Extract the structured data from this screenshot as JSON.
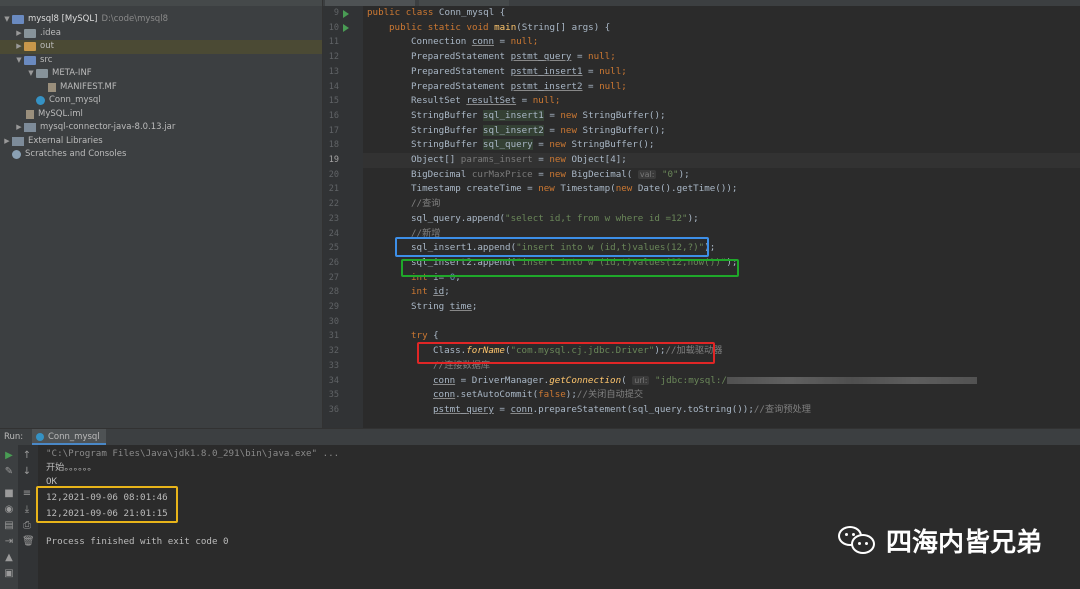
{
  "project_tree": {
    "items": [
      {
        "label": "mysql8 [MySQL]",
        "path": "D:\\code\\mysql8",
        "icon": "folder-icon"
      },
      {
        "label": ".idea",
        "icon": "folder-icon"
      },
      {
        "label": "out",
        "icon": "folder-icon"
      },
      {
        "label": "src",
        "icon": "folder-icon"
      },
      {
        "label": "META-INF",
        "icon": "folder-icon"
      },
      {
        "label": "MANIFEST.MF",
        "icon": "file-icon"
      },
      {
        "label": "Conn_mysql",
        "icon": "class-icon"
      },
      {
        "label": "MySQL.iml",
        "icon": "file-icon"
      },
      {
        "label": "mysql-connector-java-8.0.13.jar",
        "icon": "jar-icon"
      },
      {
        "label": "External Libraries",
        "icon": "library-icon"
      },
      {
        "label": "Scratches and Consoles",
        "icon": "scratches-icon"
      }
    ]
  },
  "editor": {
    "line_numbers": [
      "9",
      "10",
      "11",
      "12",
      "13",
      "14",
      "15",
      "16",
      "17",
      "18",
      "19",
      "20",
      "21",
      "22",
      "23",
      "24",
      "25",
      "26",
      "27",
      "28",
      "29",
      "30",
      "31",
      "32",
      "33",
      "34",
      "35",
      "36"
    ],
    "current_line": "19",
    "code": {
      "l9_kw": "public class ",
      "l9_name": "Conn_mysql {",
      "l10_kw": "public static void ",
      "l10_fn": "main",
      "l10_rest": "(String[] args) {",
      "l11_type": "Connection ",
      "l11_var": "conn",
      "l11_rest": " = ",
      "l11_null": "null",
      "l11_end": ";",
      "l12_type": "PreparedStatement ",
      "l12_var": "pstmt_query",
      "l12_rest": " = ",
      "l12_null": "null",
      "l12_end": ";",
      "l13_type": "PreparedStatement ",
      "l13_var": "pstmt_insert1",
      "l13_rest": " = ",
      "l13_null": "null",
      "l13_end": ";",
      "l14_type": "PreparedStatement ",
      "l14_var": "pstmt_insert2",
      "l14_rest": " = ",
      "l14_null": "null",
      "l14_end": ";",
      "l15_type": "ResultSet ",
      "l15_var": "resultSet",
      "l15_rest": " = ",
      "l15_null": "null",
      "l15_end": ";",
      "l16_type": "StringBuffer ",
      "l16_var": "sql_insert1",
      "l16_rest": " = ",
      "l16_new": "new ",
      "l16_end": "StringBuffer();",
      "l17_type": "StringBuffer ",
      "l17_var": "sql_insert2",
      "l17_rest": " = ",
      "l17_new": "new ",
      "l17_end": "StringBuffer();",
      "l18_type": "StringBuffer ",
      "l18_var": "sql_query",
      "l18_rest": " = ",
      "l18_new": "new ",
      "l18_end": "StringBuffer();",
      "l19_type": "Object[] ",
      "l19_var": "params_insert",
      "l19_rest": " = ",
      "l19_new": "new ",
      "l19_end": "Object[4];",
      "l20_type": "BigDecimal ",
      "l20_var": "curMaxPrice",
      "l20_rest": " = ",
      "l20_new": "new ",
      "l20_mid": "BigDecimal( ",
      "l20_hint": "val:",
      "l20_str": " \"0\"",
      "l20_end": ");",
      "l21_type": "Timestamp createTime = ",
      "l21_new": "new ",
      "l21_mid": "Timestamp(",
      "l21_new2": "new ",
      "l21_end": "Date().getTime());",
      "l22_cmt": "//查询",
      "l23_pre": "sql_query.append(",
      "l23_str": "\"select id,t from w where id =12\"",
      "l23_end": ");",
      "l24_cmt": "//新增",
      "l25_pre": "sql_insert1.append(",
      "l25_str": "\"insert into w (id,t)values(12,?)\"",
      "l25_end": ");",
      "l26_pre": "sql_insert2.append(",
      "l26_str": "\"insert into w (id,t)values(12,now())\"",
      "l26_end": ");",
      "l27_kw": "int ",
      "l27_rest": "i= ",
      "l27_num": "0",
      "l27_end": ";",
      "l28_kw": "int ",
      "l28_var": "id",
      "l28_end": ";",
      "l29_type": "String ",
      "l29_var": "time",
      "l29_end": ";",
      "l31_kw": "try",
      "l31_end": " {",
      "l32_pre": "Class.",
      "l32_fn": "forName",
      "l32_open": "(",
      "l32_str": "\"com.mysql.cj.jdbc.Driver\"",
      "l32_end": ");",
      "l32_cmt": "//加载驱动器",
      "l33_cmt": "//连接数据库",
      "l34_var": "conn",
      "l34_mid": " = DriverManager.",
      "l34_fn": "getConnection",
      "l34_open": "( ",
      "l34_hint": "url:",
      "l34_str": " \"jdbc:mysql:/",
      "l35_var": "conn",
      "l35_mid": ".setAutoCommit(",
      "l35_kw": "false",
      "l35_end": ");",
      "l35_cmt": "//关闭自动提交",
      "l36_var": "pstmt_query",
      "l36_mid": " = ",
      "l36_var2": "conn",
      "l36_end": ".prepareStatement(sql_query.toString());",
      "l36_cmt": "//查询预处理"
    },
    "highlights": {
      "blue": "#3d8fe8",
      "green": "#1fa82a",
      "red": "#e02626",
      "yellow": "#e8b41a"
    }
  },
  "run_panel": {
    "label": "Run:",
    "tab": "Conn_mysql",
    "lines": [
      "\"C:\\Program Files\\Java\\jdk1.8.0_291\\bin\\java.exe\" ...",
      "开始。。。。。。",
      "OK",
      "12,2021-09-06 08:01:46",
      "12,2021-09-06 21:01:15",
      "",
      "Process finished with exit code 0"
    ]
  },
  "watermark": {
    "text": "四海内皆兄弟",
    "icon": "wechat-icon"
  }
}
